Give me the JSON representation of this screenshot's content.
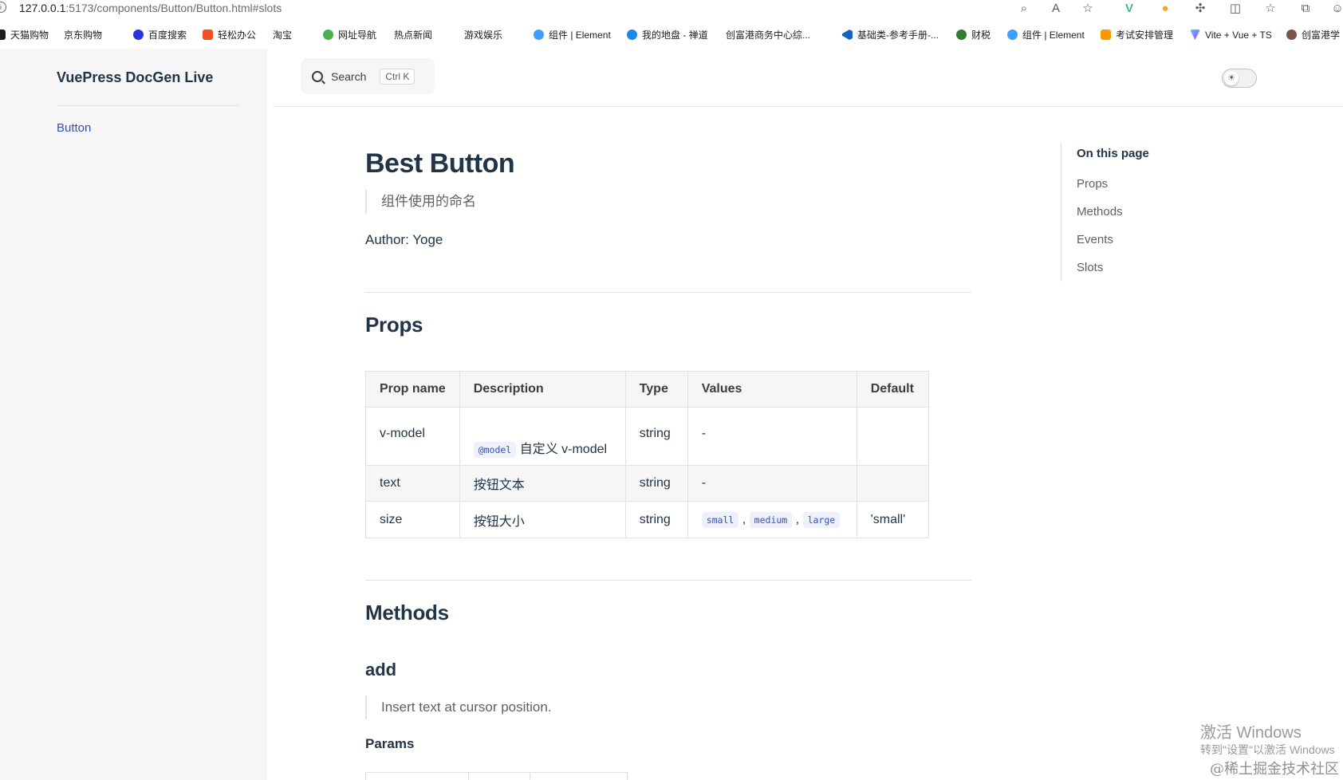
{
  "browser": {
    "url_host": "127.0.0.1",
    "url_rest": ":5173/components/Button/Button.html#slots",
    "bookmarks": [
      {
        "label": "天猫购物",
        "icon": "tmall-icon"
      },
      {
        "label": "京东购物",
        "icon": "page-icon"
      },
      {
        "label": "百度搜索",
        "icon": "baidu-icon"
      },
      {
        "label": "轻松办公",
        "icon": "office-icon"
      },
      {
        "label": "淘宝",
        "icon": "page-icon"
      },
      {
        "label": "网址导航",
        "icon": "nav-icon"
      },
      {
        "label": "热点新闻",
        "icon": "page-icon"
      },
      {
        "label": "游戏娱乐",
        "icon": "page-icon"
      },
      {
        "label": "组件 | Element",
        "icon": "element-icon"
      },
      {
        "label": "我的地盘 - 禅道",
        "icon": "zentao-icon"
      },
      {
        "label": "创富港商务中心综...",
        "icon": "page-icon"
      },
      {
        "label": "基础类-参考手册-...",
        "icon": "vscode-icon"
      },
      {
        "label": "财税",
        "icon": "tax-icon"
      },
      {
        "label": "组件 | Element",
        "icon": "element-icon"
      },
      {
        "label": "考试安排管理",
        "icon": "exam-icon"
      },
      {
        "label": "Vite + Vue + TS",
        "icon": "vite-icon"
      },
      {
        "label": "创富港学",
        "icon": "cfg-icon"
      }
    ]
  },
  "sidebar": {
    "site_title": "VuePress DocGen Live",
    "items": [
      {
        "label": "Button"
      }
    ]
  },
  "nav": {
    "search_label": "Search",
    "search_shortcut": "Ctrl K"
  },
  "doc": {
    "title": "Best Button",
    "description": "组件使用的命名",
    "author": "Author: Yoge",
    "props_heading": "Props",
    "props_table": {
      "headers": [
        "Prop name",
        "Description",
        "Type",
        "Values",
        "Default"
      ],
      "rows": [
        {
          "name": "v-model",
          "desc_code": "@model",
          "desc_text": "自定义 v-model",
          "type": "string",
          "values": "-",
          "default": ""
        },
        {
          "name": "text",
          "desc_text": "按钮文本",
          "type": "string",
          "values": "-",
          "default": ""
        },
        {
          "name": "size",
          "desc_text": "按钮大小",
          "type": "string",
          "values_codes": [
            "small",
            "medium",
            "large"
          ],
          "values_sep": ",",
          "default": "'small'"
        }
      ]
    },
    "methods_heading": "Methods",
    "method_name": "add",
    "method_desc": "Insert text at cursor position.",
    "params_heading": "Params"
  },
  "toc": {
    "title": "On this page",
    "links": [
      "Props",
      "Methods",
      "Events",
      "Slots"
    ]
  },
  "watermarks": {
    "activate_title": "激活 Windows",
    "activate_sub": "转到\"设置\"以激活 Windows",
    "juejin": "@稀土掘金技术社区"
  }
}
